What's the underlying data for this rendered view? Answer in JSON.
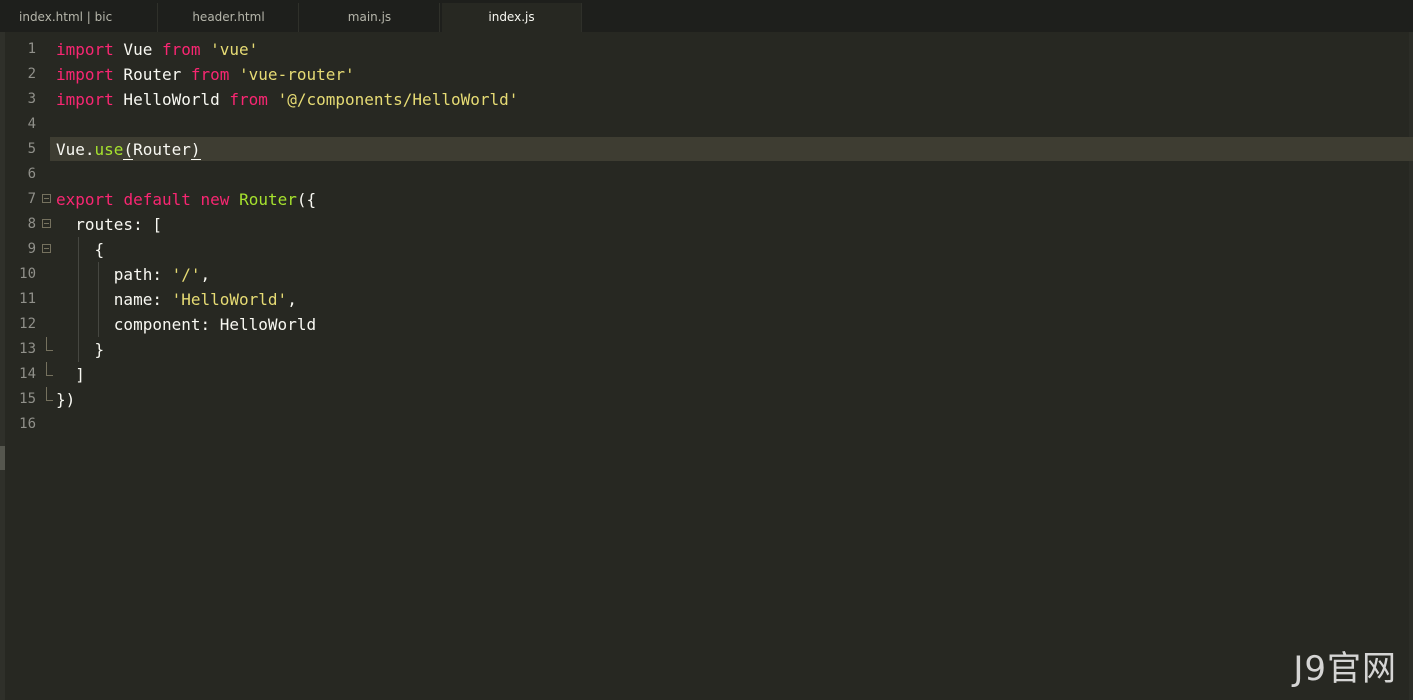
{
  "tabs": [
    {
      "label": "index.html | bic",
      "active": false
    },
    {
      "label": "header.html",
      "active": false
    },
    {
      "label": "main.js",
      "active": false
    },
    {
      "label": "index.js",
      "active": true
    }
  ],
  "editor": {
    "language": "javascript",
    "highlighted_line": 5,
    "lines": [
      {
        "n": "1",
        "tokens": [
          {
            "t": "import",
            "c": "k"
          },
          {
            "t": " Vue ",
            "c": "i"
          },
          {
            "t": "from",
            "c": "k"
          },
          {
            "t": " ",
            "c": "i"
          },
          {
            "t": "'vue'",
            "c": "s"
          }
        ]
      },
      {
        "n": "2",
        "tokens": [
          {
            "t": "import",
            "c": "k"
          },
          {
            "t": " Router ",
            "c": "i"
          },
          {
            "t": "from",
            "c": "k"
          },
          {
            "t": " ",
            "c": "i"
          },
          {
            "t": "'vue-router'",
            "c": "s"
          }
        ]
      },
      {
        "n": "3",
        "tokens": [
          {
            "t": "import",
            "c": "k"
          },
          {
            "t": " HelloWorld ",
            "c": "i"
          },
          {
            "t": "from",
            "c": "k"
          },
          {
            "t": " ",
            "c": "i"
          },
          {
            "t": "'@/components/HelloWorld'",
            "c": "s"
          }
        ]
      },
      {
        "n": "4",
        "tokens": []
      },
      {
        "n": "5",
        "tokens": [
          {
            "t": "Vue.",
            "c": "i"
          },
          {
            "t": "use",
            "c": "f"
          },
          {
            "t": "(",
            "c": "i bracket"
          },
          {
            "t": "Router",
            "c": "i"
          },
          {
            "t": ")",
            "c": "i bracket"
          }
        ]
      },
      {
        "n": "6",
        "tokens": []
      },
      {
        "n": "7",
        "fold": "open",
        "tokens": [
          {
            "t": "export",
            "c": "k"
          },
          {
            "t": " ",
            "c": "i"
          },
          {
            "t": "default",
            "c": "k"
          },
          {
            "t": " ",
            "c": "i"
          },
          {
            "t": "new",
            "c": "k"
          },
          {
            "t": " ",
            "c": "i"
          },
          {
            "t": "Router",
            "c": "f"
          },
          {
            "t": "({",
            "c": "i"
          }
        ]
      },
      {
        "n": "8",
        "fold": "open",
        "tokens": [
          {
            "t": "  routes: [",
            "c": "i"
          }
        ]
      },
      {
        "n": "9",
        "fold": "open",
        "tokens": [
          {
            "t": "    {",
            "c": "i"
          }
        ]
      },
      {
        "n": "10",
        "tokens": [
          {
            "t": "      path: ",
            "c": "i"
          },
          {
            "t": "'/'",
            "c": "s"
          },
          {
            "t": ",",
            "c": "i"
          }
        ]
      },
      {
        "n": "11",
        "tokens": [
          {
            "t": "      name: ",
            "c": "i"
          },
          {
            "t": "'HelloWorld'",
            "c": "s"
          },
          {
            "t": ",",
            "c": "i"
          }
        ]
      },
      {
        "n": "12",
        "tokens": [
          {
            "t": "      component: HelloWorld",
            "c": "i"
          }
        ]
      },
      {
        "n": "13",
        "fold": "end",
        "tokens": [
          {
            "t": "    }",
            "c": "i"
          }
        ]
      },
      {
        "n": "14",
        "fold": "end",
        "tokens": [
          {
            "t": "  ]",
            "c": "i"
          }
        ]
      },
      {
        "n": "15",
        "fold": "end",
        "tokens": [
          {
            "t": "})",
            "c": "i"
          }
        ]
      },
      {
        "n": "16",
        "tokens": []
      }
    ]
  },
  "watermark": "J9官网",
  "colors": {
    "background": "#272822",
    "keyword": "#f92672",
    "string": "#e6db74",
    "function": "#a6e22e",
    "text": "#f8f8f2",
    "line_number": "#90908a",
    "line_highlight": "#3e3d32"
  }
}
